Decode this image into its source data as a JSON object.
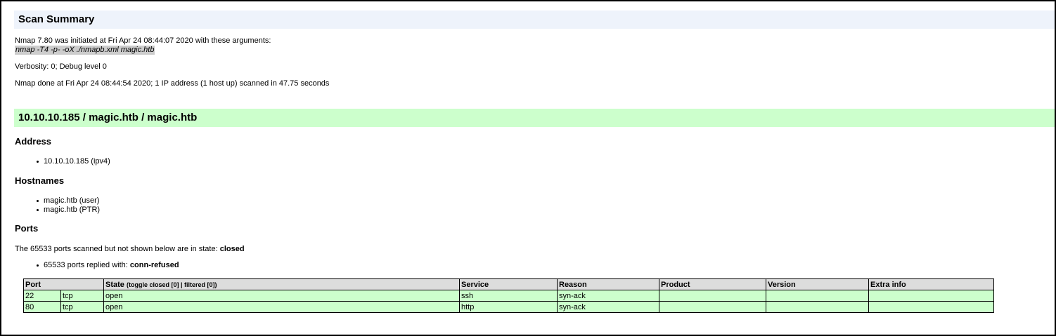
{
  "scan_summary": {
    "title": "Scan Summary",
    "initiated": "Nmap 7.80 was initiated at Fri Apr 24 08:44:07 2020 with these arguments:",
    "arguments": "nmap -T4 -p- -oX ./nmapb.xml magic.htb",
    "verbosity": "Verbosity: 0; Debug level 0",
    "done": "Nmap done at Fri Apr 24 08:44:54 2020; 1 IP address (1 host up) scanned in 47.75 seconds"
  },
  "host": {
    "title": "10.10.10.185 / magic.htb / magic.htb",
    "address_heading": "Address",
    "addresses": [
      "10.10.10.185 (ipv4)"
    ],
    "hostnames_heading": "Hostnames",
    "hostnames": [
      "magic.htb (user)",
      "magic.htb (PTR)"
    ],
    "ports_heading": "Ports",
    "ports_note_prefix": "The 65533 ports scanned but not shown below are in state: ",
    "ports_note_state": "closed",
    "replied_prefix": "65533 ports replied with: ",
    "replied_reason": "conn-refused"
  },
  "ports_table": {
    "headers": {
      "port": "Port",
      "state": "State",
      "toggle_prefix": "(toggle ",
      "toggle_closed": "closed [0]",
      "toggle_sep": " | ",
      "toggle_filtered": "filtered [0]",
      "toggle_suffix": ")",
      "service": "Service",
      "reason": "Reason",
      "product": "Product",
      "version": "Version",
      "extra": "Extra info"
    },
    "rows": [
      {
        "port": "22",
        "proto": "tcp",
        "state": "open",
        "service": "ssh",
        "reason": "syn-ack",
        "product": "",
        "version": "",
        "extra": ""
      },
      {
        "port": "80",
        "proto": "tcp",
        "state": "open",
        "service": "http",
        "reason": "syn-ack",
        "product": "",
        "version": "",
        "extra": ""
      }
    ]
  }
}
